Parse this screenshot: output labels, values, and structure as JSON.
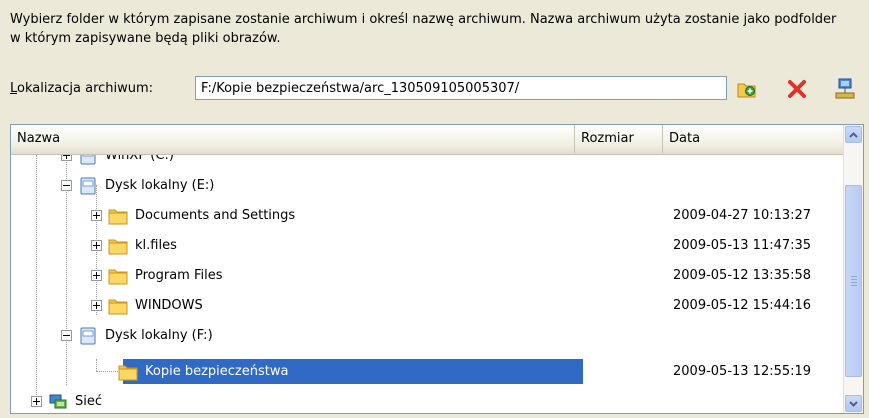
{
  "instructions": "Wybierz folder w którym zapisane zostanie archiwum i określ nazwę archiwum. Nazwa archiwum użyta zostanie jako podfolder w którym zapisywane będą pliki obrazów.",
  "location": {
    "label_underlined": "L",
    "label_rest": "okalizacja archiwum:",
    "value": "F:/Kopie bezpieczeństwa/arc_130509105005307/"
  },
  "toolbar": {
    "new_folder_icon": "new-folder-icon",
    "delete_icon": "delete-icon",
    "network_icon": "network-icon"
  },
  "columns": {
    "name": "Nazwa",
    "size": "Rozmiar",
    "date": "Data"
  },
  "tree": [
    {
      "label": "WinXP (C:)",
      "date": "",
      "icon": "drive-icon",
      "expander": "plus"
    },
    {
      "label": "Dysk lokalny (E:)",
      "date": "",
      "icon": "drive-icon",
      "expander": "minus"
    },
    {
      "label": "Documents and Settings",
      "date": "2009-04-27 10:13:27",
      "icon": "folder-icon",
      "expander": "plus"
    },
    {
      "label": "kl.files",
      "date": "2009-05-13 11:47:35",
      "icon": "folder-icon",
      "expander": "plus"
    },
    {
      "label": "Program Files",
      "date": "2009-05-12 13:35:58",
      "icon": "folder-icon",
      "expander": "plus"
    },
    {
      "label": "WINDOWS",
      "date": "2009-05-12 15:44:16",
      "icon": "folder-icon",
      "expander": "plus"
    },
    {
      "label": "Dysk lokalny (F:)",
      "date": "",
      "icon": "drive-icon",
      "expander": "minus"
    },
    {
      "label": "Kopie bezpieczeństwa",
      "date": "2009-05-13 12:55:19",
      "icon": "folder-open-icon",
      "expander": "none"
    },
    {
      "label": "Sieć",
      "date": "",
      "icon": "network-places-icon",
      "expander": "plus"
    }
  ],
  "colors": {
    "selection": "#316ac5",
    "window_bg": "#ece9d8",
    "folder": "#f5c542"
  }
}
